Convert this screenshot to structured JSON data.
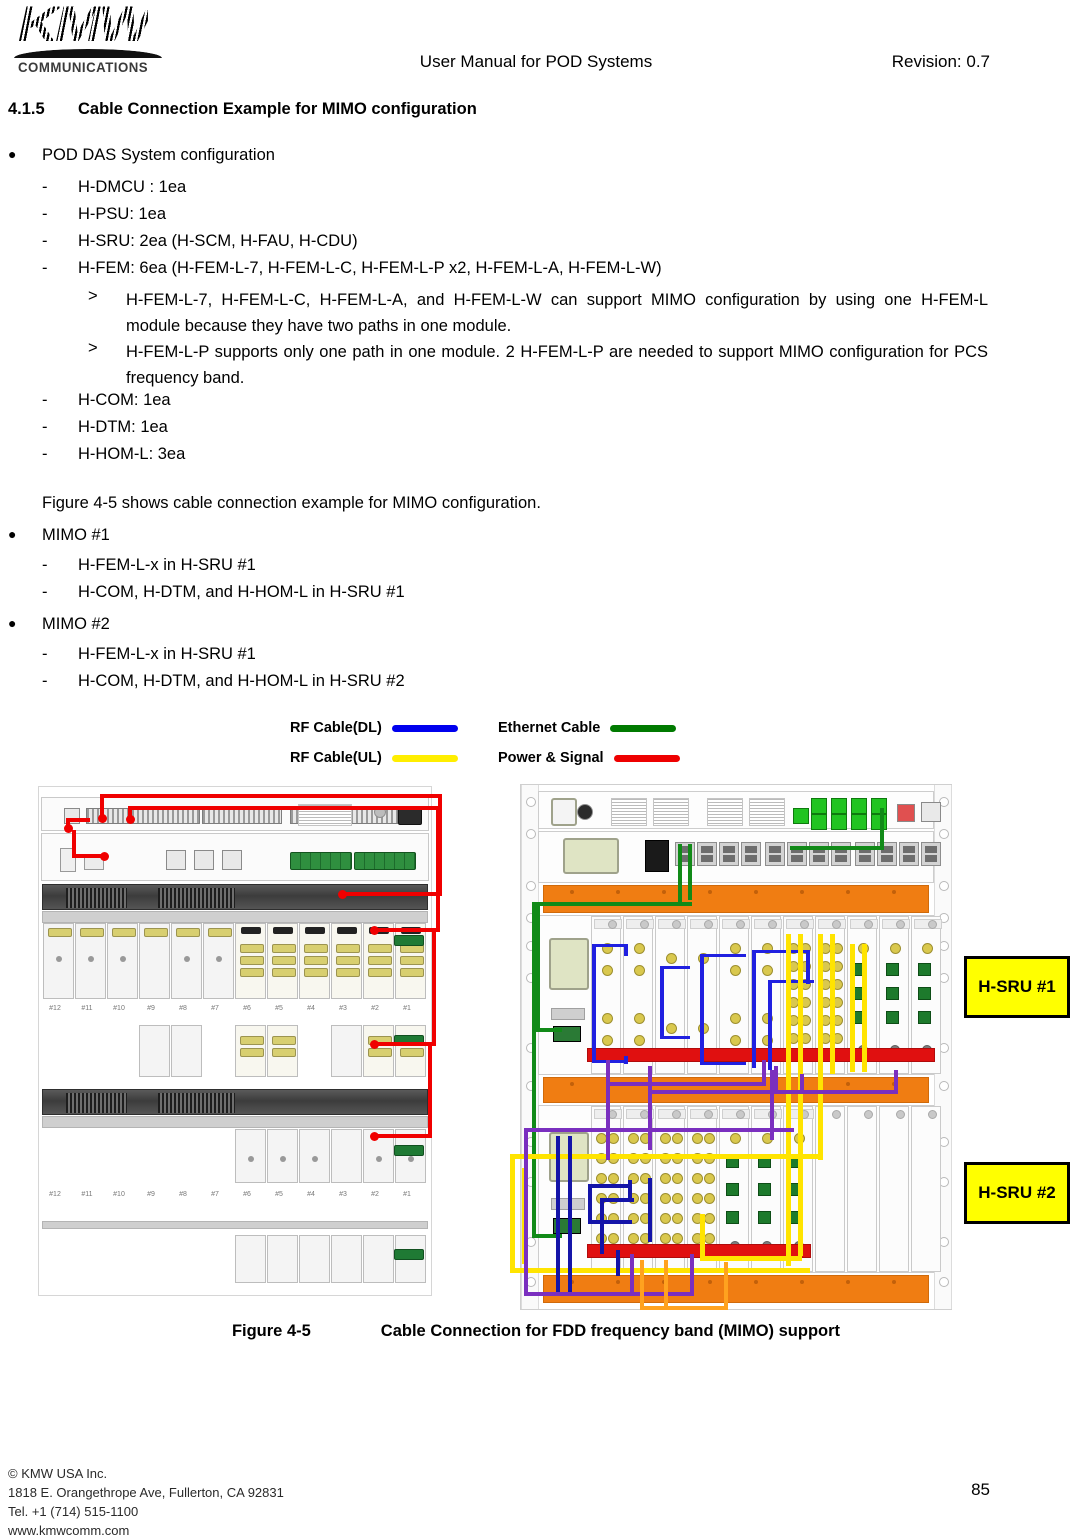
{
  "header": {
    "logo_letters": "KMW",
    "logo_word": "COMMUNICATIONS",
    "title": "User Manual for POD Systems",
    "revision": "Revision: 0.7"
  },
  "section": {
    "number": "4.1.5",
    "title": "Cable Connection Example for MIMO configuration"
  },
  "bullets": {
    "pod_das": "POD DAS System configuration",
    "mimo1": "MIMO #1",
    "mimo2": "MIMO #2"
  },
  "dashes": {
    "hdmcu": "H-DMCU : 1ea",
    "hpsu": "H-PSU: 1ea",
    "hsru": "H-SRU: 2ea (H-SCM, H-FAU, H-CDU)",
    "hfem": "H-FEM: 6ea (H-FEM-L-7, H-FEM-L-C, H-FEM-L-P x2, H-FEM-L-A, H-FEM-L-W)",
    "hcom": "H-COM: 1ea",
    "hdtm": "H-DTM: 1ea",
    "hhoml": "H-HOM-L: 3ea",
    "mimo1_a": "H-FEM-L-x in H-SRU #1",
    "mimo1_b": "H-COM, H-DTM, and H-HOM-L in H-SRU #1",
    "mimo2_a": "H-FEM-L-x in H-SRU #1",
    "mimo2_b": "H-COM, H-DTM, and H-HOM-L in H-SRU #2"
  },
  "angles": {
    "marker": ">",
    "note1": "H-FEM-L-7, H-FEM-L-C, H-FEM-L-A, and H-FEM-L-W can support MIMO configuration by using one H-FEM-L module because they have two paths in one module.",
    "note2": "H-FEM-L-P supports only one path in one module. 2 H-FEM-L-P are needed to support MIMO configuration for PCS frequency band."
  },
  "figure_intro": "Figure 4-5 shows cable connection example for MIMO configuration.",
  "legend": {
    "items": [
      {
        "label": "RF Cable(DL)",
        "color": "#0000ee"
      },
      {
        "label": "RF Cable(UL)",
        "color": "#ffee00"
      },
      {
        "label": "Ethernet Cable",
        "color": "#007a00"
      },
      {
        "label": "Power & Signal",
        "color": "#ee0000"
      }
    ]
  },
  "diagram": {
    "sru1_label": "H-SRU #1",
    "sru2_label": "H-SRU #2",
    "left_port_labels": [
      "#12",
      "#11",
      "#10",
      "#9",
      "#8",
      "#7",
      "#6",
      "#5",
      "#4",
      "#3",
      "#2",
      "#1"
    ]
  },
  "figure": {
    "number": "Figure 4-5",
    "caption": "Cable Connection for FDD frequency band (MIMO) support"
  },
  "footer": {
    "line1": "© KMW USA Inc.",
    "line2": "1818 E. Orangethrope Ave, Fullerton, CA 92831",
    "line3": "Tel. +1 (714) 515-1100",
    "line4": "www.kmwcomm.com",
    "page": "85"
  }
}
